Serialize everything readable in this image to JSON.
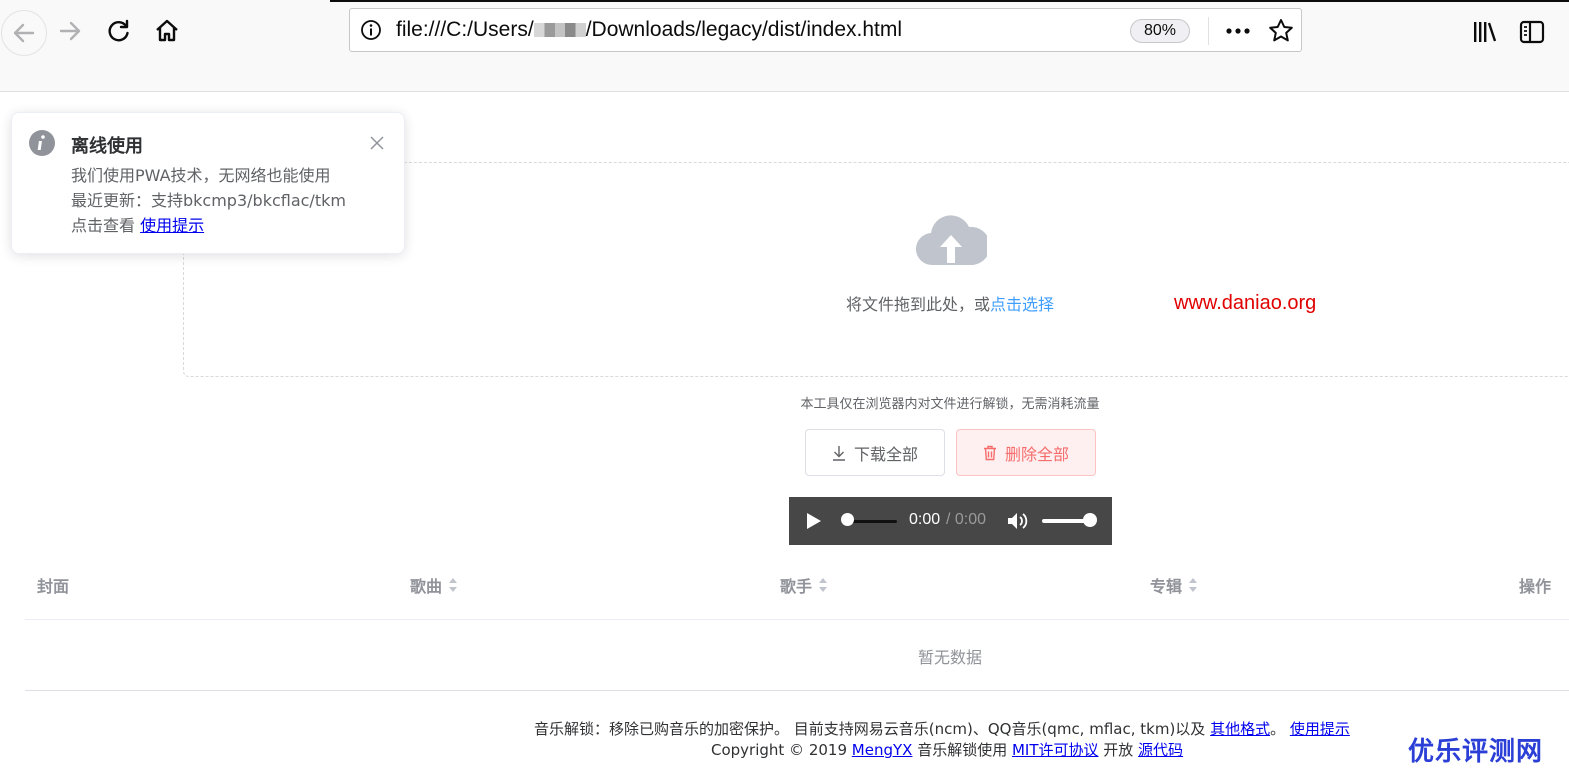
{
  "browser": {
    "url_before": "file:///C:/Users/",
    "url_after": "/Downloads/legacy/dist/index.html",
    "zoom": "80%",
    "icons": [
      "back-arrow-icon",
      "forward-arrow-icon",
      "reload-icon",
      "home-icon",
      "info-icon",
      "more-icon",
      "bookmark-star-icon",
      "library-icon",
      "sidebar-icon"
    ]
  },
  "notification": {
    "title": "离线使用",
    "line1": "我们使用PWA技术，无网络也能使用",
    "line2": "最近更新：支持bkcmp3/bkcflac/tkm",
    "line3_prefix": "点击查看 ",
    "line3_link": "使用提示"
  },
  "upload": {
    "text": "将文件拖到此处，或",
    "pick_link": "点击选择",
    "hint": "本工具仅在浏览器内对文件进行解锁，无需消耗流量"
  },
  "watermark_url": "www.daniao.org",
  "buttons": {
    "download_all": "下载全部",
    "delete_all": "删除全部"
  },
  "player": {
    "current_time": "0:00",
    "duration": "/ 0:00",
    "volume": 1.0
  },
  "table": {
    "columns": [
      "封面",
      "歌曲",
      "歌手",
      "专辑",
      "操作"
    ],
    "empty_text": "暂无数据"
  },
  "footer": {
    "line1_text": "音乐解锁：移除已购音乐的加密保护。 目前支持网易云音乐(ncm)、QQ音乐(qmc, mflac, tkm)以及 ",
    "line1_link1": "其他格式",
    "line1_mid": "。 ",
    "line1_link2": "使用提示",
    "line2_prefix": "Copyright © 2019 ",
    "line2_author": "MengYX",
    "line2_mid": " 音乐解锁使用 ",
    "line2_license": "MIT许可协议",
    "line2_mid2": " 开放 ",
    "line2_source": "源代码"
  },
  "corner_watermark": "优乐评测网",
  "colors": {
    "link_blue": "#409eff",
    "danger": "#f56c6c",
    "watermark_red": "#e00000",
    "corner_blue": "#2b3fd6"
  }
}
